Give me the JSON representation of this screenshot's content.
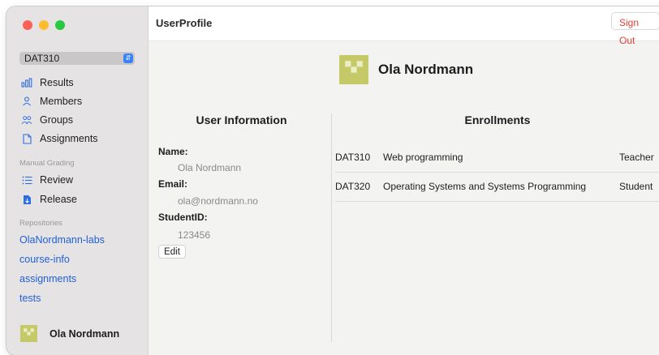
{
  "window": {
    "traffic_lights": {
      "close_color": "#fe5f57",
      "minimize_color": "#febc2e",
      "zoom_color": "#28c840"
    }
  },
  "sidebar": {
    "course_selector": {
      "value": "DAT310"
    },
    "nav": [
      {
        "label": "Results",
        "icon": "chart-bars-icon"
      },
      {
        "label": "Members",
        "icon": "person-icon"
      },
      {
        "label": "Groups",
        "icon": "people-icon"
      },
      {
        "label": "Assignments",
        "icon": "document-icon"
      }
    ],
    "manual_grading": {
      "heading": "Manual Grading",
      "items": [
        {
          "label": "Review",
          "icon": "list-icon"
        },
        {
          "label": "Release",
          "icon": "document-filled-icon"
        }
      ]
    },
    "repositories": {
      "heading": "Repositories",
      "items": [
        "OlaNordmann-labs",
        "course-info",
        "assignments",
        "tests"
      ]
    },
    "user": {
      "name": "Ola Nordmann"
    }
  },
  "topbar": {
    "title": "UserProfile",
    "sign_out": "Sign Out"
  },
  "profile": {
    "name": "Ola Nordmann",
    "avatar_color": "#c5c968"
  },
  "user_info": {
    "heading": "User Information",
    "fields": [
      {
        "label": "Name:",
        "value": "Ola Nordmann"
      },
      {
        "label": "Email:",
        "value": "ola@nordmann.no"
      },
      {
        "label": "StudentID:",
        "value": "123456"
      }
    ],
    "edit_label": "Edit"
  },
  "enrollments": {
    "heading": "Enrollments",
    "rows": [
      {
        "code": "DAT310",
        "name": "Web programming",
        "role": "Teacher"
      },
      {
        "code": "DAT320",
        "name": "Operating Systems and Systems Programming",
        "role": "Student"
      }
    ]
  },
  "colors": {
    "accent": "#2260d8",
    "sign_out": "#e0413b",
    "avatar": "#c5c968"
  }
}
